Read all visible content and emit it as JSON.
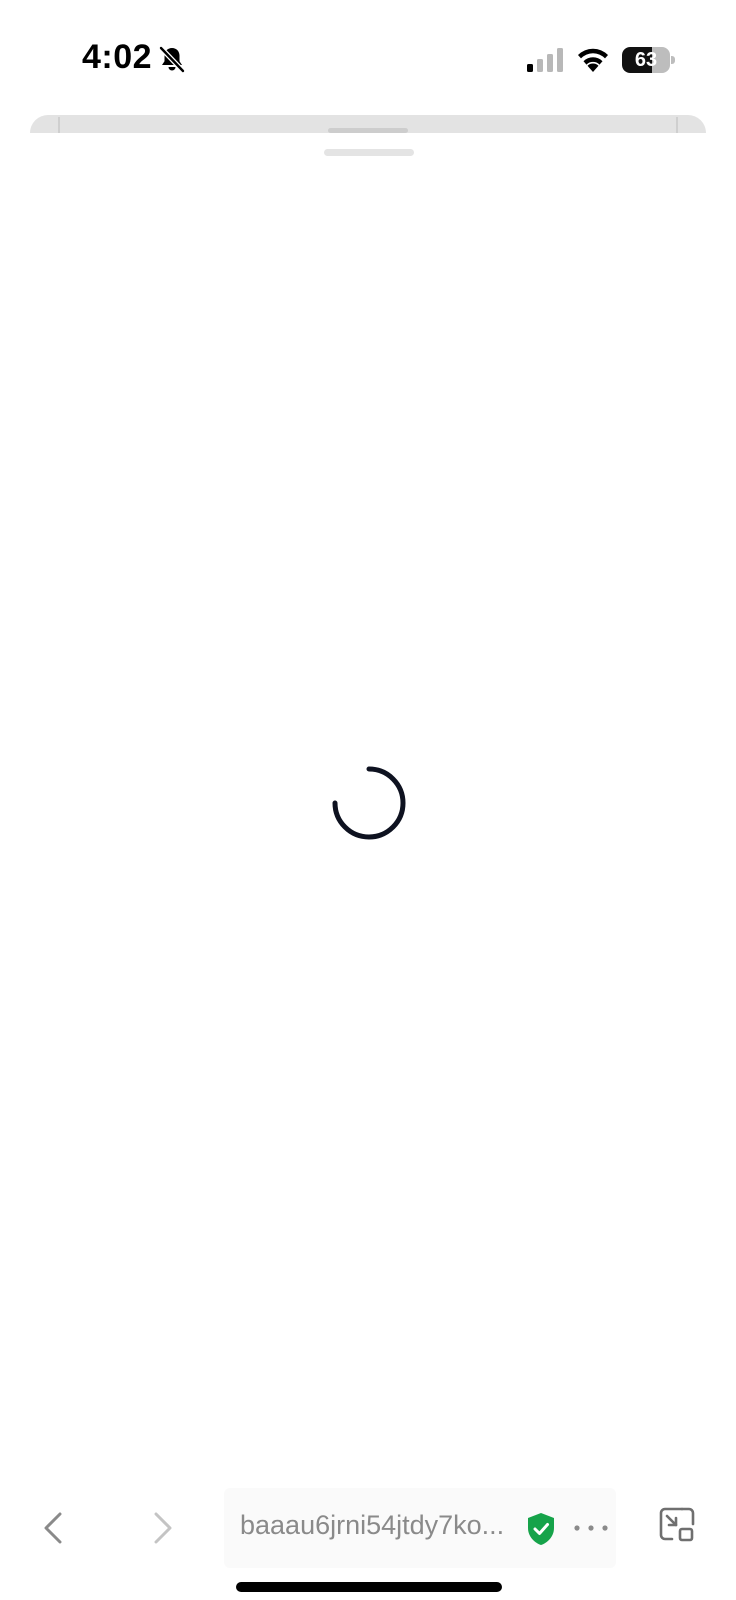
{
  "status_bar": {
    "time": "4:02",
    "battery_percent": "63",
    "battery_level": 0.63,
    "icons": [
      "bell-slash-icon",
      "cellular-signal-icon",
      "wifi-icon",
      "battery-icon"
    ]
  },
  "content": {
    "state": "loading",
    "spinner_icon": "loading-spinner-icon",
    "spinner_color": "#0e1220"
  },
  "browser_toolbar": {
    "back_icon": "chevron-left-icon",
    "forward_icon": "chevron-right-icon",
    "url": "baaau6jrni54jtdy7ko...",
    "secure_icon": "verified-shield-icon",
    "secure_color": "#16a34a",
    "more_icon": "more-horizontal-icon",
    "minimize_icon": "minimize-window-icon"
  }
}
